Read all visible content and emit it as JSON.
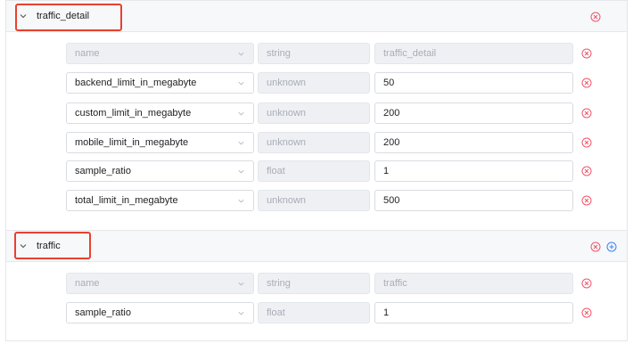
{
  "colors": {
    "remove": "#f0566b",
    "add": "#3b82f6",
    "highlight": "#e8412f"
  },
  "groups": [
    {
      "name": "traffic_detail",
      "icons": [
        "remove-circle-icon"
      ],
      "rows": [
        {
          "key": "name",
          "type": "string",
          "value": "traffic_detail",
          "disabled": true
        },
        {
          "key": "backend_limit_in_megabyte",
          "type": "unknown",
          "value": "50",
          "disabled": false
        },
        {
          "key": "custom_limit_in_megabyte",
          "type": "unknown",
          "value": "200",
          "disabled": false
        },
        {
          "key": "mobile_limit_in_megabyte",
          "type": "unknown",
          "value": "200",
          "disabled": false
        },
        {
          "key": "sample_ratio",
          "type": "float",
          "value": "1",
          "disabled": false
        },
        {
          "key": "total_limit_in_megabyte",
          "type": "unknown",
          "value": "500",
          "disabled": false
        }
      ]
    },
    {
      "name": "traffic",
      "icons": [
        "remove-circle-icon",
        "add-circle-icon"
      ],
      "rows": [
        {
          "key": "name",
          "type": "string",
          "value": "traffic",
          "disabled": true
        },
        {
          "key": "sample_ratio",
          "type": "float",
          "value": "1",
          "disabled": false
        }
      ]
    }
  ]
}
